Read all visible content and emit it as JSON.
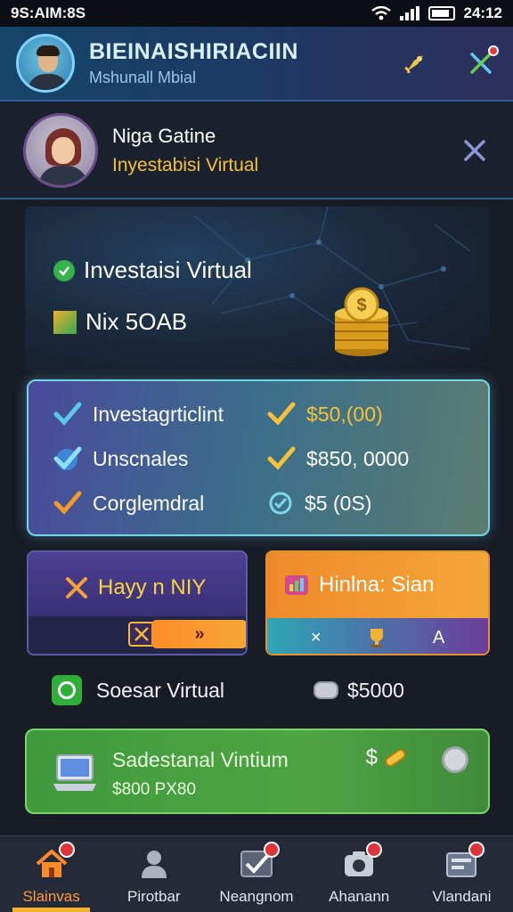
{
  "status_bar": {
    "left_text": "9S:AIM:8S",
    "time": "24:12"
  },
  "header": {
    "title": "BIEINAISHIRIACIIN",
    "subtitle": "Mshunall Mbial"
  },
  "profile": {
    "name": "Niga Gatine",
    "subtitle": "Inyestabisi Virtual"
  },
  "hero": {
    "line1": "Investaisi Virtual",
    "line2": "Nix 5OAB"
  },
  "stats": [
    {
      "label": "Investagrticlint",
      "value": "$50,(00)",
      "icon": "check-icon",
      "value_icon": "check-icon",
      "value_color": "#f6c23a"
    },
    {
      "label": "Unscnales",
      "value": "$850, 0000",
      "icon": "check-shield-icon",
      "value_icon": "check-icon",
      "value_color": "#ffffff"
    },
    {
      "label": "Corglemdral",
      "value": "$5 (0S)",
      "icon": "check-icon",
      "value_icon": "check-circle-icon",
      "value_color": "#ffffff"
    }
  ],
  "buttons": {
    "left_label": "Hayy n NIY",
    "left_pill": "»",
    "right_label": "Hinlna: Sian",
    "right_bottom_left": "×",
    "right_bottom_right": "A"
  },
  "info": {
    "label": "Soesar Virtual",
    "value": "$5000"
  },
  "green_card": {
    "title": "Sadestanal Vintium",
    "subtitle": "$800 PX80",
    "dollar": "$"
  },
  "nav": [
    {
      "label": "Slainvas",
      "icon": "home-icon",
      "active": true
    },
    {
      "label": "Pirotbar",
      "icon": "person-icon",
      "active": false
    },
    {
      "label": "Neangnom",
      "icon": "chart-check-icon",
      "active": false
    },
    {
      "label": "Ahanann",
      "icon": "camera-icon",
      "active": false
    },
    {
      "label": "Vlandani",
      "icon": "wallet-icon",
      "active": false
    }
  ]
}
